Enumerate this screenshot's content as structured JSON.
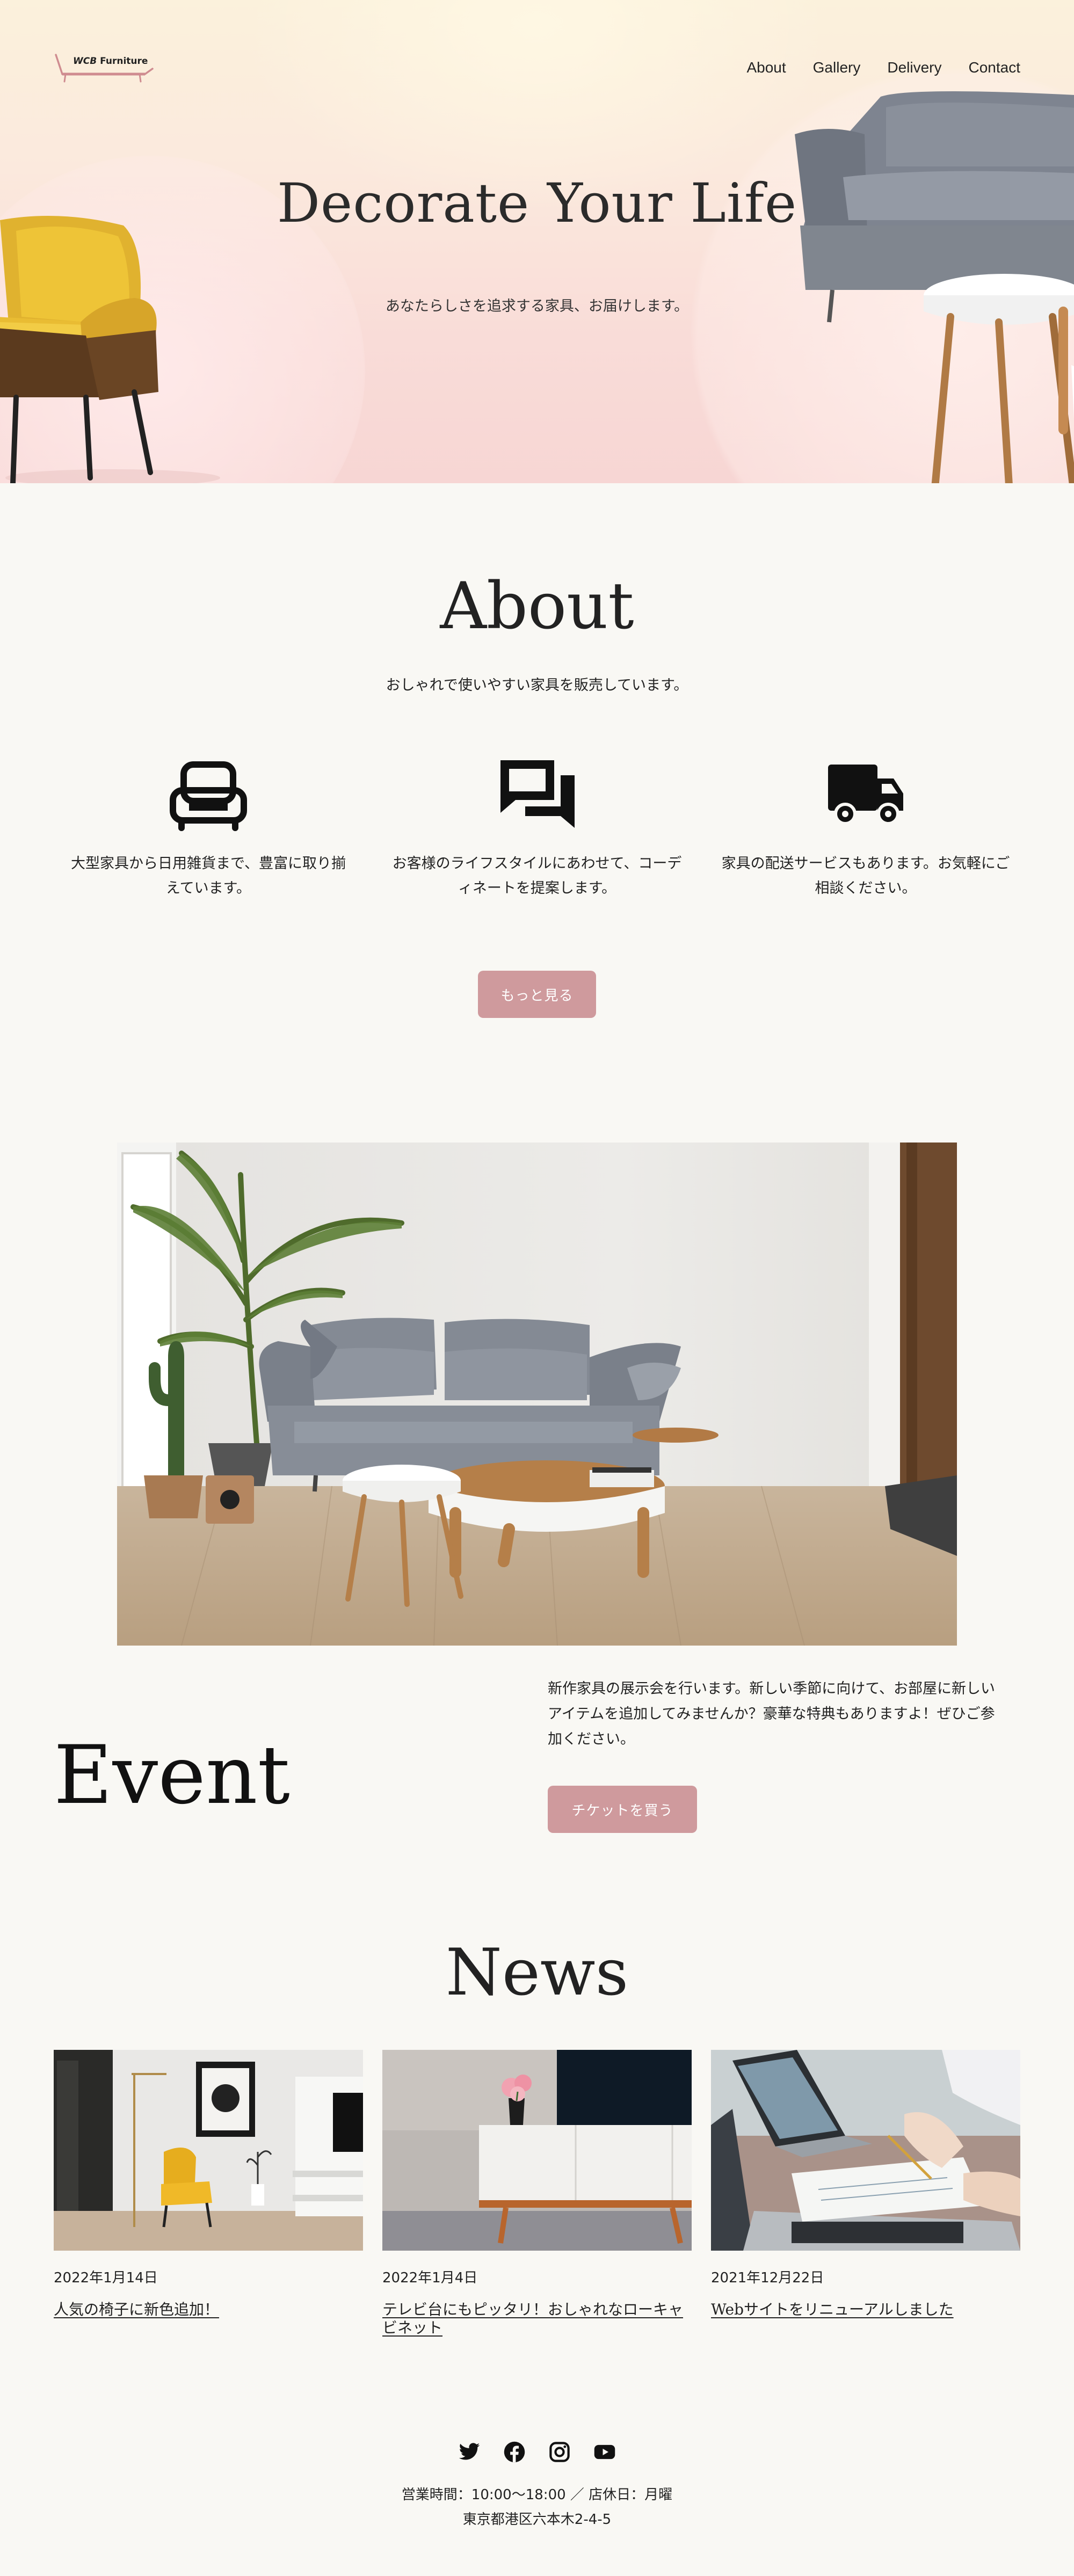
{
  "header": {
    "logo_prefix": "WCB",
    "logo_suffix": "Furniture",
    "nav": [
      "About",
      "Gallery",
      "Delivery",
      "Contact"
    ]
  },
  "hero": {
    "title": "Decorate Your Life",
    "subtitle": "あなたらしさを追求する家具、お届けします。"
  },
  "about": {
    "title": "About",
    "subtitle": "おしゃれで使いやすい家具を販売しています。",
    "features": [
      {
        "icon": "armchair-icon",
        "text_line1": "大型家具から日用雑貨まで、豊富に取り揃",
        "text_line2": "えています。"
      },
      {
        "icon": "chat-bubbles-icon",
        "text_line1": "お客様のライフスタイルにあわせて、コーデ",
        "text_line2": "ィネートを提案します。"
      },
      {
        "icon": "delivery-truck-icon",
        "text_line1": "家具の配送サービスもあります。お気軽にご",
        "text_line2": "相談ください。"
      }
    ],
    "more_button": "もっと見る"
  },
  "event": {
    "title": "Event",
    "text_line1": "新作家具の展示会を行います。新しい季節に向けて、お部屋に新しい",
    "text_line2": "アイテムを追加してみませんか？豪華な特典もありますよ！ぜひご参",
    "text_line3": "加ください。",
    "ticket_button": "チケットを買う"
  },
  "news": {
    "title": "News",
    "items": [
      {
        "date": "2022年1月14日",
        "title_line1": "人気の椅子に新色追加！",
        "title_line2": ""
      },
      {
        "date": "2022年1月4日",
        "title_line1": "テレビ台にもピッタリ！おしゃれなローキャ",
        "title_line2": "ビネット"
      },
      {
        "date": "2021年12月22日",
        "title_line1": "Webサイトをリニューアルしました",
        "title_line2": ""
      }
    ]
  },
  "footer": {
    "social": [
      "twitter-icon",
      "facebook-icon",
      "instagram-icon",
      "youtube-icon"
    ],
    "hours": "営業時間：10:00〜18:00 ／ 店休日：月曜",
    "address": "東京都港区六本木2-4-5"
  },
  "colors": {
    "accent": "#cf9a9d",
    "background": "#f9f8f4",
    "hero_pink": "#f7d6d4"
  }
}
